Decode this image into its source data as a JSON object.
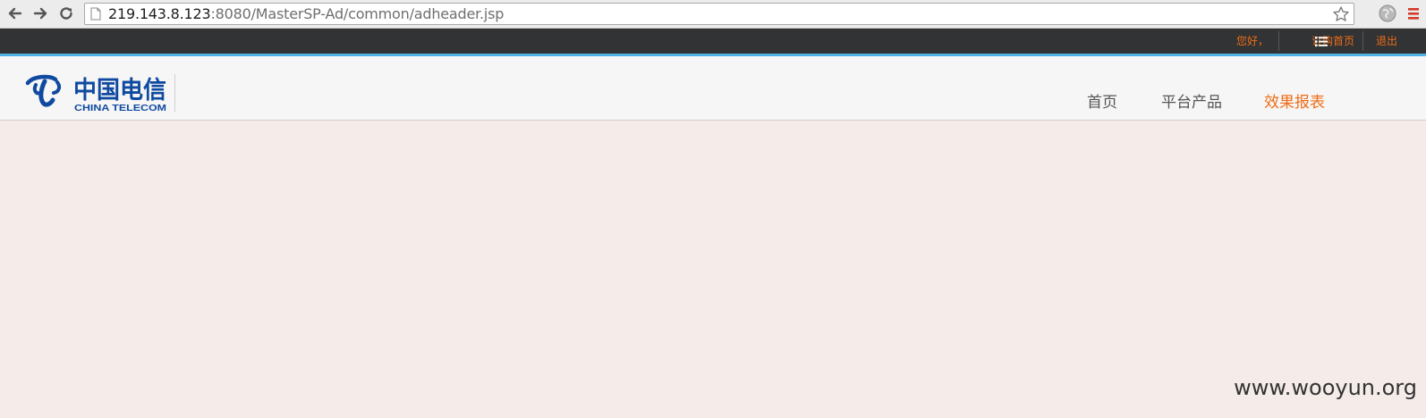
{
  "browser": {
    "url_host": "219.143.8.123",
    "url_rest": ":8080/MasterSP-Ad/common/adheader.jsp"
  },
  "topbar": {
    "greeting": "您好，",
    "order_home": "订购首页",
    "logout": "退出"
  },
  "logo": {
    "text_cn": "中国电信",
    "text_en": "CHINA TELECOM"
  },
  "nav": {
    "items": [
      "首页",
      "平台产品",
      "效果报表"
    ],
    "active_index": 2
  },
  "watermark": "www.wooyun.org",
  "colors": {
    "accent": "#ee6d16",
    "topbar_bg": "#313335",
    "blue_line": "#4fb3e6",
    "page_bg": "#f5ece9",
    "logo_blue": "#0f4aa0"
  }
}
